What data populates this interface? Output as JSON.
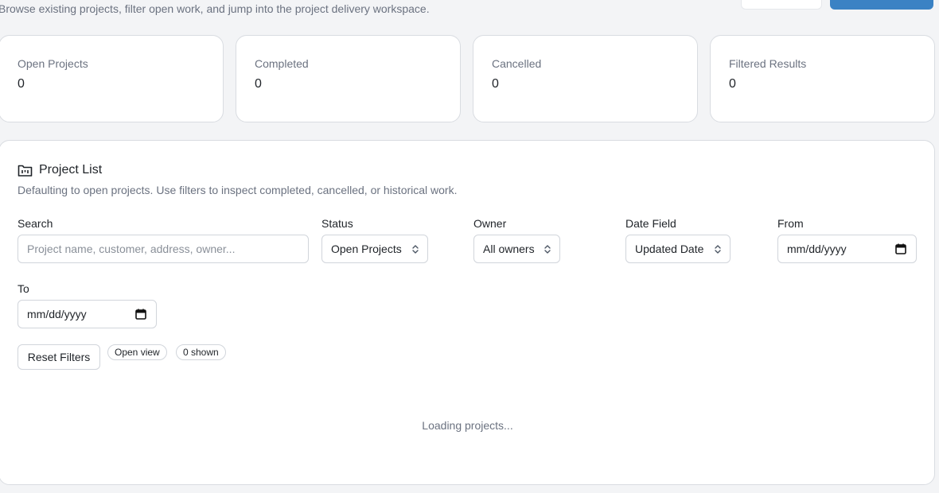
{
  "header": {
    "subtitle": "Browse existing projects, filter open work, and jump into the project delivery workspace."
  },
  "stats": [
    {
      "label": "Open Projects",
      "value": "0"
    },
    {
      "label": "Completed",
      "value": "0"
    },
    {
      "label": "Cancelled",
      "value": "0"
    },
    {
      "label": "Filtered Results",
      "value": "0"
    }
  ],
  "panel": {
    "title": "Project List",
    "title_icon": "folder-icon",
    "description": "Defaulting to open projects. Use filters to inspect completed, cancelled, or historical work."
  },
  "filters": {
    "search": {
      "label": "Search",
      "value": "",
      "placeholder": "Project name, customer, address, owner..."
    },
    "status": {
      "label": "Status",
      "value": "Open Projects"
    },
    "owner": {
      "label": "Owner",
      "value": "All owners"
    },
    "date_field": {
      "label": "Date Field",
      "value": "Updated Date"
    },
    "from": {
      "label": "From",
      "value": "mm/dd/yyyy"
    },
    "to": {
      "label": "To",
      "value": "mm/dd/yyyy"
    }
  },
  "actions": {
    "reset_label": "Reset Filters"
  },
  "badges": {
    "view": "Open view",
    "shown": "0 shown"
  },
  "status_text": "Loading projects...",
  "colors": {
    "accent": "#3b82c4",
    "background": "#f3f4f6",
    "muted_text": "#6b7280"
  }
}
